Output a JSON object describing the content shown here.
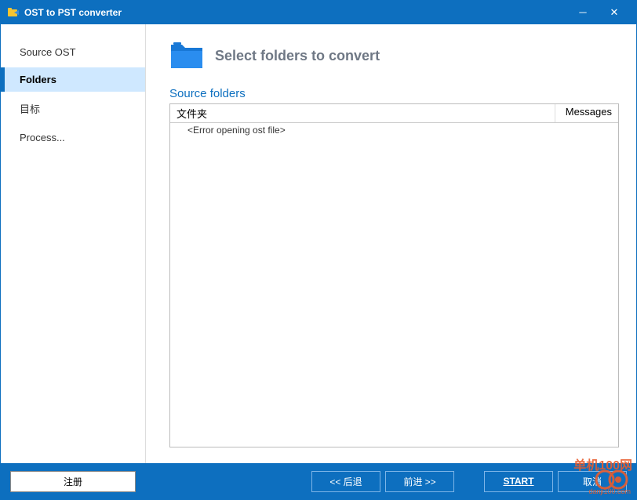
{
  "titlebar": {
    "title": "OST to PST converter"
  },
  "sidebar": {
    "items": [
      {
        "label": "Source OST",
        "active": false
      },
      {
        "label": "Folders",
        "active": true
      },
      {
        "label": "目标",
        "active": false
      },
      {
        "label": "Process...",
        "active": false
      }
    ]
  },
  "content": {
    "title": "Select folders to convert",
    "section_label": "Source folders",
    "columns": {
      "folder": "文件夹",
      "messages": "Messages"
    },
    "rows": [
      {
        "text": "<Error opening ost file>"
      }
    ]
  },
  "bottombar": {
    "register": "注册",
    "back": "<< 后退",
    "forward": "前进 >>",
    "start": "START",
    "cancel": "取消"
  },
  "watermark": {
    "text": "单机100网",
    "url": "danji100.com"
  }
}
